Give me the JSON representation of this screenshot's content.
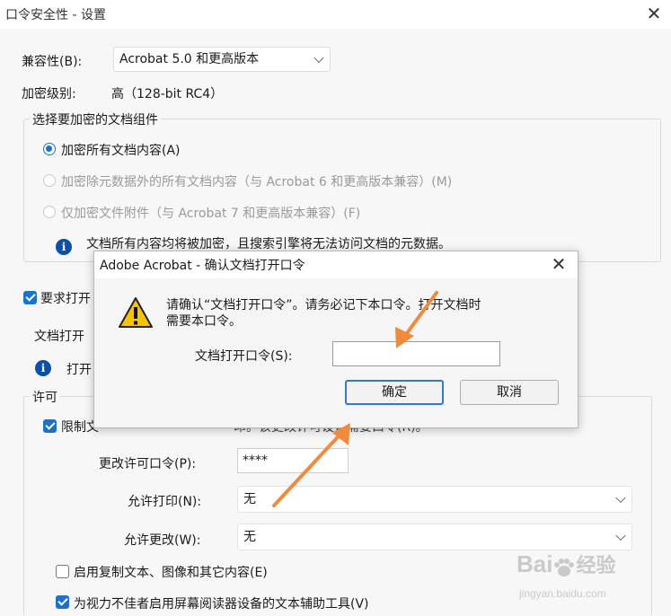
{
  "window": {
    "title": "口令安全性 - 设置",
    "close_glyph": "✕"
  },
  "compat": {
    "label": "兼容性(B):",
    "value": "Acrobat 5.0 和更高版本"
  },
  "encrypt_level": {
    "label": "加密级别:",
    "value": "高（128-bit RC4）"
  },
  "components": {
    "legend": "选择要加密的文档组件",
    "options": [
      {
        "label": "加密所有文档内容(A)",
        "selected": true,
        "enabled": true
      },
      {
        "label": "加密除元数据外的所有文档内容（与 Acrobat 6 和更高版本兼容）(M)",
        "selected": false,
        "enabled": false
      },
      {
        "label": "仅加密文件附件（与 Acrobat 7 和更高版本兼容）(F)",
        "selected": false,
        "enabled": false
      }
    ],
    "info_text": "文档所有内容均将被加密，且搜索引擎将无法访问文档的元数据。"
  },
  "open_password": {
    "checkbox_label_visible": "要求打开",
    "section_label_visible": "文档打开",
    "info_text_visible": "打开"
  },
  "permissions": {
    "legend": "许可",
    "restrict_label_visible": "限制文",
    "restrict_label_tail": "印。该更改许可设置需要口令(R)。",
    "change_pw_label": "更改许可口令(P):",
    "change_pw_value": "****",
    "print_label": "允许打印(N):",
    "print_value": "无",
    "change_label": "允许更改(W):",
    "change_value": "无",
    "copy_label": "启用复制文本、图像和其它内容(E)",
    "copy_checked": false,
    "screenreader_label": "为视力不佳者启用屏幕阅读器设备的文本辅助工具(V)",
    "screenreader_checked": true
  },
  "dialog": {
    "title": "Adobe Acrobat - 确认文档打开口令",
    "close_glyph": "✕",
    "warning_icon": "warning-icon",
    "message_line1": "请确认“文档打开口令”。请务必记下本口令。打开文档时",
    "message_line2": "需要本口令。",
    "field_label": "文档打开口令(S):",
    "field_value": "",
    "ok_label": "确定",
    "cancel_label": "取消"
  },
  "watermark": {
    "brand": "Bai",
    "brand2": "经验",
    "site": "jingyan.baidu.com"
  },
  "colors": {
    "accent": "#1a73c9",
    "arrow": "#f08a3c"
  }
}
